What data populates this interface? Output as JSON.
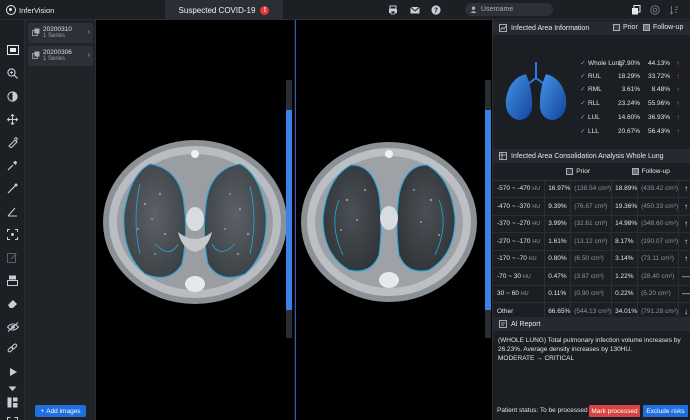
{
  "app": {
    "brand": "InferVision"
  },
  "header": {
    "tab_title": "Suspected COVID-19",
    "alert": "!",
    "username": "Username"
  },
  "series": {
    "items": [
      {
        "name": "20200310",
        "count": "1 Series"
      },
      {
        "name": "20200306",
        "count": "1 Series"
      }
    ],
    "add_label": "Add images"
  },
  "infected_area": {
    "title": "Infected Area Information",
    "col_prior": "Prior",
    "col_followup": "Follow-up",
    "rows": [
      {
        "name": "Whole Lung",
        "prior": "17.90%",
        "followup": "44.13%"
      },
      {
        "name": "RUL",
        "prior": "18.29%",
        "followup": "33.72%"
      },
      {
        "name": "RML",
        "prior": "3.61%",
        "followup": "8.48%"
      },
      {
        "name": "RLL",
        "prior": "23.24%",
        "followup": "55.96%"
      },
      {
        "name": "LUL",
        "prior": "14.60%",
        "followup": "36.93%"
      },
      {
        "name": "LLL",
        "prior": "20.67%",
        "followup": "56.43%"
      }
    ]
  },
  "consolidation": {
    "title": "Infected Area Consolidation Analysis Whole Lung",
    "col_prior": "Prior",
    "col_followup": "Follow-up",
    "rows": [
      {
        "range": "-570 ~ -470",
        "unit": "HU",
        "prior_pct": "16.97%",
        "prior_vol": "(138.54 cm³)",
        "fu_pct": "18.89%",
        "fu_vol": "(439.42 cm³)",
        "trend": "up"
      },
      {
        "range": "-470 ~ -370",
        "unit": "HU",
        "prior_pct": "9.39%",
        "prior_vol": "(76.67 cm³)",
        "fu_pct": "19.36%",
        "fu_vol": "(450.33 cm³)",
        "trend": "up"
      },
      {
        "range": "-370 ~ -270",
        "unit": "HU",
        "prior_pct": "3.99%",
        "prior_vol": "(32.61 cm³)",
        "fu_pct": "14.98%",
        "fu_vol": "(348.60 cm³)",
        "trend": "up"
      },
      {
        "range": "-270 ~ -170",
        "unit": "HU",
        "prior_pct": "1.61%",
        "prior_vol": "(13.12 cm³)",
        "fu_pct": "8.17%",
        "fu_vol": "(190.07 cm³)",
        "trend": "up"
      },
      {
        "range": "-170 ~ -70",
        "unit": "HU",
        "prior_pct": "0.80%",
        "prior_vol": "(6.50 cm³)",
        "fu_pct": "3.14%",
        "fu_vol": "(73.11 cm³)",
        "trend": "up"
      },
      {
        "range": "-70 ~ 30",
        "unit": "HU",
        "prior_pct": "0.47%",
        "prior_vol": "(3.87 cm³)",
        "fu_pct": "1.22%",
        "fu_vol": "(28.40 cm³)",
        "trend": "eq"
      },
      {
        "range": "30 ~ 60",
        "unit": "HU",
        "prior_pct": "0.11%",
        "prior_vol": "(0.90 cm³)",
        "fu_pct": "0.22%",
        "fu_vol": "(5.20 cm³)",
        "trend": "eq"
      },
      {
        "range": "Other",
        "unit": "",
        "prior_pct": "66.65%",
        "prior_vol": "(544.13 cm³)",
        "fu_pct": "34.01%",
        "fu_vol": "(791.28 cm³)",
        "trend": "down"
      }
    ]
  },
  "ai_report": {
    "title": "AI Report",
    "line1": "(WHOLE LUNG) Total pulmonary infection volume increases by",
    "line2": "26.23%. Average density increases by 130HU.",
    "line3": "MODERATE → CRITICAL"
  },
  "footer": {
    "status": "Patient status: To be processed",
    "mark_label": "Mark processed",
    "exclude_label": "Exclude risks"
  },
  "colors": {
    "accent": "#1e6fe0",
    "danger": "#d84343",
    "up": "#e53935",
    "equal": "#f5a623",
    "down": "#3d9cf0"
  },
  "icons": [
    "printer-icon",
    "mail-icon",
    "help-icon",
    "user-icon",
    "copy-icon",
    "target-icon",
    "sort-icon"
  ]
}
